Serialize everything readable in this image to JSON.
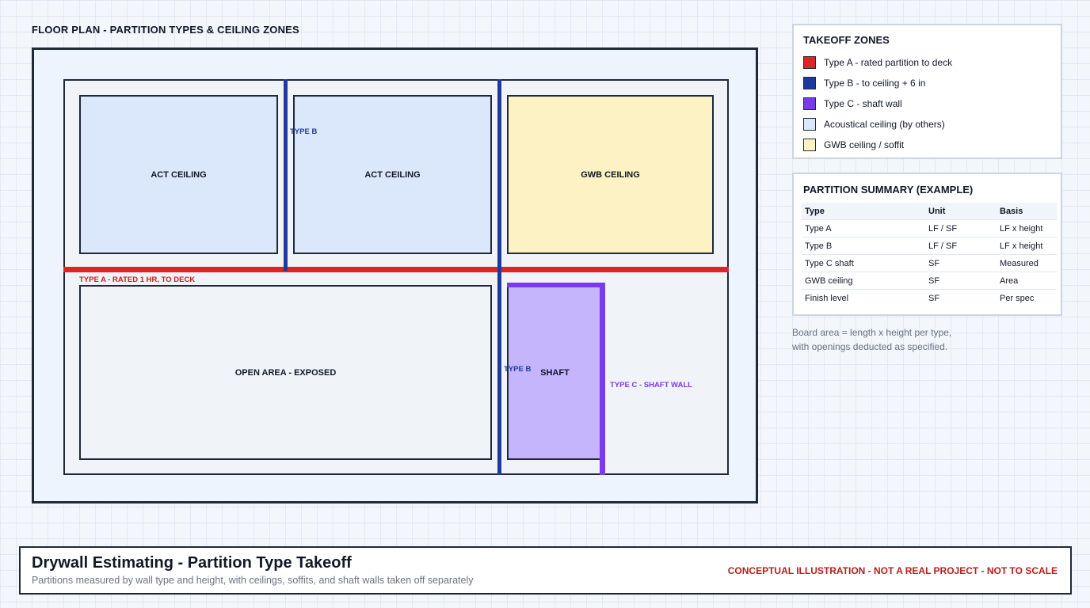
{
  "plan": {
    "title": "FLOOR PLAN - PARTITION TYPES & CEILING ZONES",
    "rooms": {
      "act1": "ACT CEILING",
      "act2": "ACT CEILING",
      "gwb": "GWB CEILING",
      "open": "OPEN AREA - EXPOSED",
      "shaft": "SHAFT"
    },
    "labels": {
      "type_b_top": "TYPE B",
      "type_a": "TYPE A - RATED 1 HR, TO DECK",
      "type_b_bottom": "TYPE B",
      "type_c": "TYPE C - SHAFT WALL"
    }
  },
  "legend": {
    "title": "TAKEOFF ZONES",
    "items": [
      {
        "label": "Type A - rated partition to deck",
        "color": "#dc2626"
      },
      {
        "label": "Type B - to ceiling + 6 in",
        "color": "#1e3a9f"
      },
      {
        "label": "Type C - shaft wall",
        "color": "#7c3aed"
      },
      {
        "label": "Acoustical ceiling (by others)",
        "color": "#dbe8fb"
      },
      {
        "label": "GWB ceiling / soffit",
        "color": "#fdf2c4"
      }
    ]
  },
  "summary": {
    "title": "PARTITION SUMMARY (EXAMPLE)",
    "headers": [
      "Type",
      "Unit",
      "Basis"
    ],
    "rows": [
      [
        "Type A",
        "LF / SF",
        "LF x height"
      ],
      [
        "Type B",
        "LF / SF",
        "LF x height"
      ],
      [
        "Type C shaft",
        "SF",
        "Measured"
      ],
      [
        "GWB ceiling",
        "SF",
        "Area"
      ],
      [
        "Finish level",
        "SF",
        "Per spec"
      ]
    ]
  },
  "note": {
    "line1": "Board area = length x height per type,",
    "line2": "with openings deducted as specified."
  },
  "footer": {
    "title": "Drywall Estimating - Partition Type Takeoff",
    "subtitle": "Partitions measured by wall type and height, with ceilings, soffits, and shaft walls taken off separately",
    "disclaimer": "CONCEPTUAL ILLUSTRATION - NOT A REAL PROJECT - NOT TO SCALE"
  }
}
